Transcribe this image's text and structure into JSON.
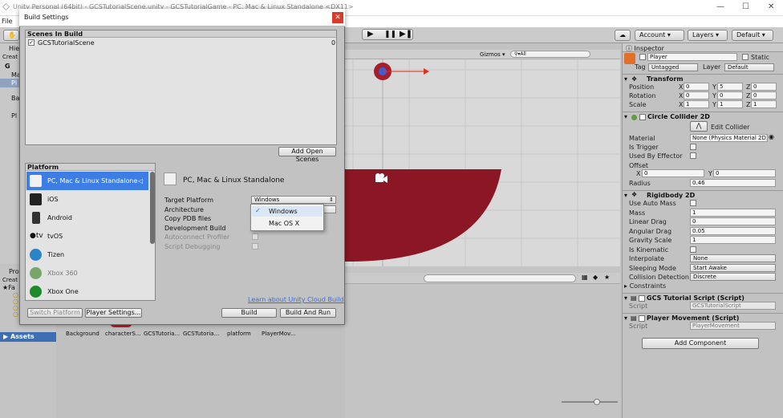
{
  "window": {
    "title": "Unity Personal (64bit) - GCSTutorialScene.unity - GCSTutorialGame - PC, Mac & Linux Standalone <DX11>"
  },
  "menu": {
    "file": "File",
    "edit": "E"
  },
  "toolbar": {
    "account": "Account",
    "layers": "Layers",
    "layout": "Default"
  },
  "hierarchy": {
    "tab": "Hie",
    "create": "Creat",
    "items": [
      "G",
      "Ma",
      "Pl",
      "Ba",
      "Pl"
    ]
  },
  "scene": {
    "gizmos": "Gizmos",
    "search": "All"
  },
  "project": {
    "tab": "Pro",
    "create": "Creat",
    "fav": "Fa",
    "assets": "Assets",
    "asset_labels": [
      "Background",
      "characterS...",
      "GCSTutoria...",
      "GCSTutoria...",
      "platform",
      "PlayerMov..."
    ]
  },
  "dialog": {
    "title": "Build Settings",
    "scenes_header": "Scenes In Build",
    "scenes": [
      {
        "name": "GCSTutorialScene",
        "index": "0"
      }
    ],
    "add_open_scenes": "Add Open Scenes",
    "platform_header": "Platform",
    "platforms": [
      "PC, Mac & Linux Standalone",
      "iOS",
      "Android",
      "tvOS",
      "Tizen",
      "Xbox 360",
      "Xbox One"
    ],
    "selected_platform": "PC, Mac & Linux Standalone",
    "options": {
      "target_platform": "Target Platform",
      "target_platform_value": "Windows",
      "architecture": "Architecture",
      "copy_pdb": "Copy PDB files",
      "development_build": "Development Build",
      "autoconnect_profiler": "Autoconnect Profiler",
      "script_debugging": "Script Debugging"
    },
    "dropdown_options": [
      "Windows",
      "Mac OS X"
    ],
    "cloud_link": "Learn about Unity Cloud Build",
    "switch_platform": "Switch Platform",
    "player_settings": "Player Settings...",
    "build": "Build",
    "build_and_run": "Build And Run"
  },
  "inspector": {
    "tab": "Inspector",
    "object_name": "Player",
    "static": "Static",
    "tag_label": "Tag",
    "tag_value": "Untagged",
    "layer_label": "Layer",
    "layer_value": "Default",
    "transform": {
      "title": "Transform",
      "position_label": "Position",
      "position": {
        "x": "0",
        "y": "5",
        "z": "0"
      },
      "rotation_label": "Rotation",
      "rotation": {
        "x": "0",
        "y": "0",
        "z": "0"
      },
      "scale_label": "Scale",
      "scale": {
        "x": "1",
        "y": "1",
        "z": "1"
      },
      "x": "X",
      "y": "Y",
      "z": "Z"
    },
    "circle_collider": {
      "title": "Circle Collider 2D",
      "edit_collider": "Edit Collider",
      "material_label": "Material",
      "material_value": "None (Physics Material 2D)",
      "is_trigger": "Is Trigger",
      "used_by_effector": "Used By Effector",
      "offset_label": "Offset",
      "offset": {
        "x": "0",
        "y": "0"
      },
      "radius_label": "Radius",
      "radius": "0.46"
    },
    "rigidbody": {
      "title": "Rigidbody 2D",
      "use_auto_mass": "Use Auto Mass",
      "mass_label": "Mass",
      "mass": "1",
      "linear_drag_label": "Linear Drag",
      "linear_drag": "0",
      "angular_drag_label": "Angular Drag",
      "angular_drag": "0.05",
      "gravity_scale_label": "Gravity Scale",
      "gravity_scale": "1",
      "is_kinematic": "Is Kinematic",
      "interpolate_label": "Interpolate",
      "interpolate": "None",
      "sleeping_mode_label": "Sleeping Mode",
      "sleeping_mode": "Start Awake",
      "collision_detection_label": "Collision Detection",
      "collision_detection": "Discrete",
      "constraints": "Constraints"
    },
    "script1": {
      "title": "GCS Tutorial Script (Script)",
      "script_label": "Script",
      "value": "GCSTutorialScript"
    },
    "script2": {
      "title": "Player Movement (Script)",
      "script_label": "Script",
      "value": "PlayerMovement"
    },
    "add_component": "Add Component"
  },
  "colors": {
    "accent": "#3d7ee6",
    "blob": "#8b1624",
    "selected": "#3d7ee6"
  }
}
